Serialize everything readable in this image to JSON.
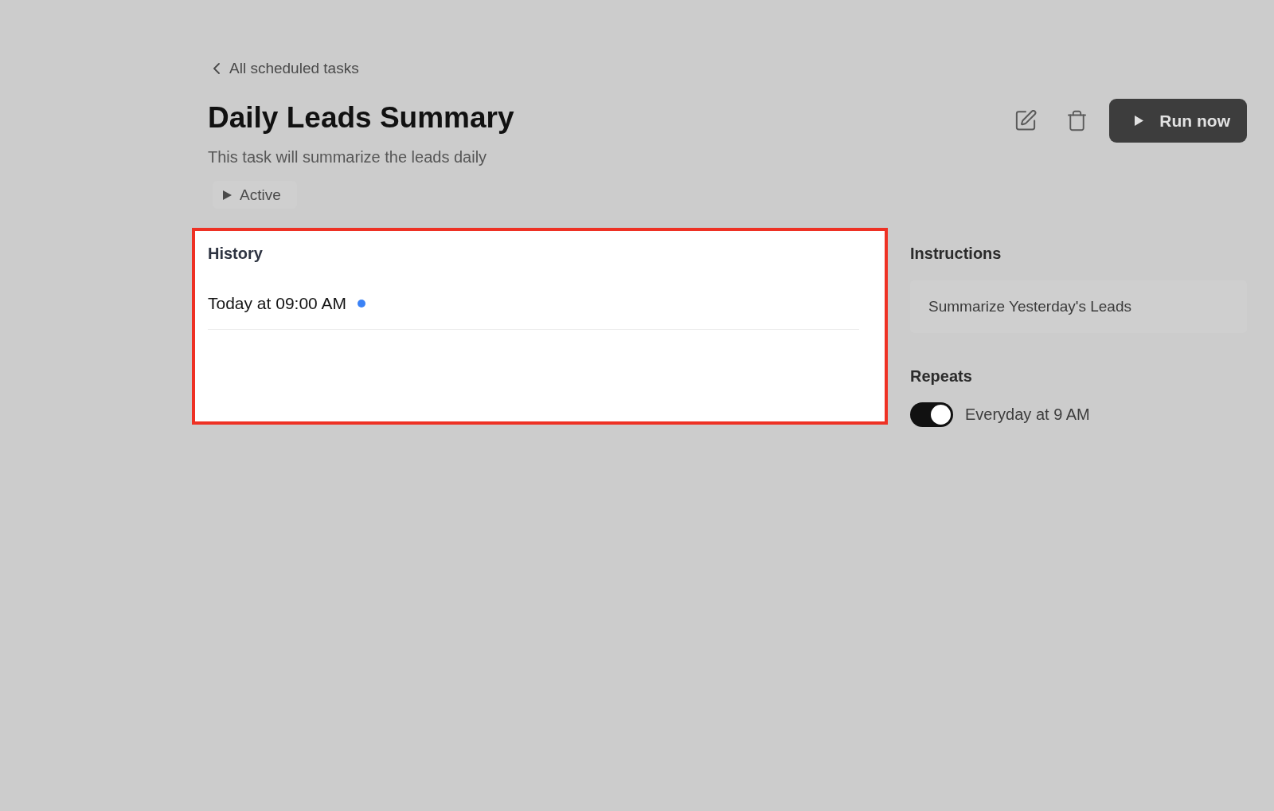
{
  "back_link": {
    "label": "All scheduled tasks"
  },
  "task": {
    "title": "Daily Leads Summary",
    "description": "This task will summarize the leads daily",
    "status": {
      "label": "Active",
      "expanded": false
    }
  },
  "run_button": {
    "label": "Run now"
  },
  "history": {
    "title": "History",
    "highlighted": true,
    "runs": [
      {
        "time": "Today at 09:00 AM",
        "color": "#3b82f6"
      }
    ]
  },
  "instructions": {
    "title": "Instructions",
    "text": "Summarize Yesterday's Leads"
  },
  "repeats": {
    "title": "Repeats",
    "on": true,
    "schedule": "Everyday at 9 AM"
  }
}
